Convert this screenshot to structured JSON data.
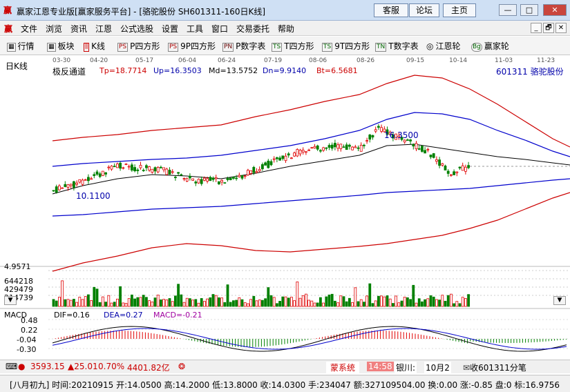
{
  "window": {
    "title": "赢家江恩专业版[赢家服务平台] - [骆驼股份  SH601311-160日K线]",
    "buttons": [
      "客服",
      "论坛",
      "主页"
    ],
    "min": "—",
    "max": "□",
    "close": "✕"
  },
  "menu": {
    "items": [
      "文件",
      "浏览",
      "资讯",
      "江恩",
      "公式选股",
      "设置",
      "工具",
      "窗口",
      "交易委托",
      "帮助"
    ],
    "mdi_buttons": [
      "_",
      "🗗",
      "✕"
    ]
  },
  "toolbar": {
    "items": [
      {
        "icon": "list-icon",
        "glyph": "▦",
        "label": "行情"
      },
      {
        "icon": "grid-icon",
        "glyph": "▦",
        "label": "板块"
      },
      {
        "icon": "kline-icon",
        "glyph": "⫼",
        "label": "K线"
      },
      {
        "icon": "ps-icon",
        "glyph": "PS",
        "label": "P四方形"
      },
      {
        "icon": "ps9-icon",
        "glyph": "PS",
        "label": "9P四方形"
      },
      {
        "icon": "pn-icon",
        "glyph": "PN",
        "label": "P数字表"
      },
      {
        "icon": "ts-icon",
        "glyph": "TS",
        "label": "T四方形"
      },
      {
        "icon": "ts9-icon",
        "glyph": "TS",
        "label": "9T四方形"
      },
      {
        "icon": "tn-icon",
        "glyph": "TN",
        "label": "T数字表"
      },
      {
        "icon": "wheel-icon",
        "glyph": "◎",
        "label": "江恩轮"
      },
      {
        "icon": "bg-icon",
        "glyph": "Bg",
        "label": "赢家轮"
      }
    ]
  },
  "chart": {
    "period_label": "日K线",
    "dates": [
      "03-30",
      "04-20",
      "05-17",
      "06-04",
      "06-24",
      "07-19",
      "08-06",
      "08-26",
      "09-15",
      "10-14",
      "11-03",
      "11-23"
    ],
    "indicator_name": "极反通道",
    "indicator_values": [
      "Tp=18.7714",
      "Up=16.3503",
      "Md=13.5752",
      "Dn=9.9140",
      "Bt=6.5681"
    ],
    "stock": "601311  骆驼股份",
    "high_mark": "16.3500",
    "low_mark": "10.1100",
    "volume_scale": [
      "4.9571",
      "644218",
      "429479",
      "214739"
    ],
    "macd_name": "MACD",
    "macd_values": [
      "DIF=0.16",
      "DEA=0.27",
      "MACD=-0.21"
    ],
    "macd_scale": [
      "0.48",
      "0.22",
      "-0.04",
      "-0.30"
    ]
  },
  "status1": {
    "index": "3593.15",
    "change": "▲25.01",
    "pct": "0.70%",
    "amount": "4401.82亿",
    "system": "蒙系统",
    "time": "14:58",
    "bank": "银川:",
    "date": "10月2",
    "receive": "收601311分笔"
  },
  "status2": {
    "text": "[八月初九] 时间:20210915 开:14.0500 高:14.2000 低:13.8000 收:14.0300 手:234047 额:327109504.00 换:0.00 涨:-0.85 盘:0 标:16.9756"
  },
  "chart_data": {
    "type": "line",
    "title": "",
    "colors": {
      "up": "#e00000",
      "down": "#008000",
      "upper": "#cc0000",
      "mid": "#0000cc",
      "base": "#000000"
    }
  }
}
